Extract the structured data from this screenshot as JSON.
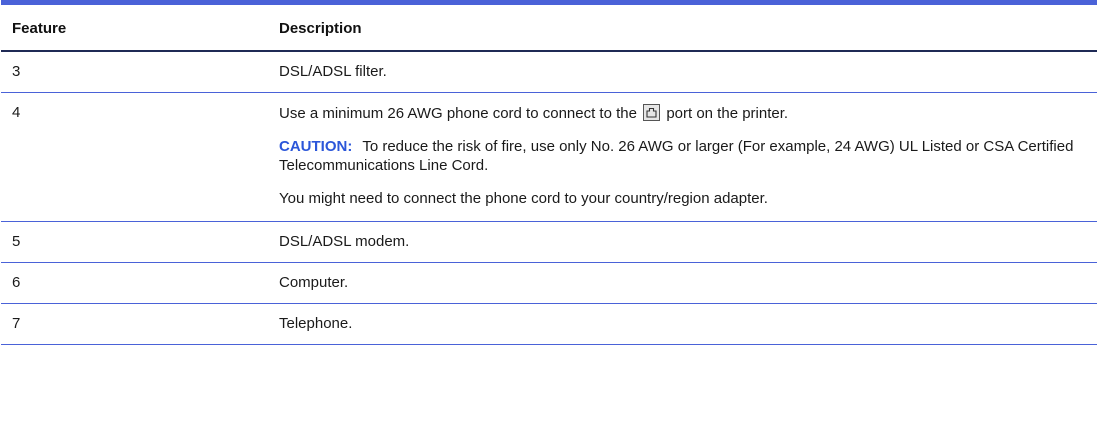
{
  "header": {
    "feature": "Feature",
    "description": "Description"
  },
  "rows": [
    {
      "feature": "3",
      "description": "DSL/ADSL filter."
    },
    {
      "feature": "4",
      "line_before_icon": "Use a minimum 26 AWG phone cord to connect to the",
      "line_after_icon": "port on the printer.",
      "icon": "phone-port-icon",
      "caution_label": "CAUTION:",
      "caution_text": "To reduce the risk of fire, use only No. 26 AWG or larger (For example, 24 AWG) UL Listed or CSA Certified Telecommunications Line Cord.",
      "note": "You might need to connect the phone cord to your country/region adapter."
    },
    {
      "feature": "5",
      "description": "DSL/ADSL modem."
    },
    {
      "feature": "6",
      "description": "Computer."
    },
    {
      "feature": "7",
      "description": "Telephone."
    }
  ],
  "colors": {
    "accent": "#4a62d8",
    "caution": "#2b56d9",
    "text": "#1a1a1a"
  }
}
